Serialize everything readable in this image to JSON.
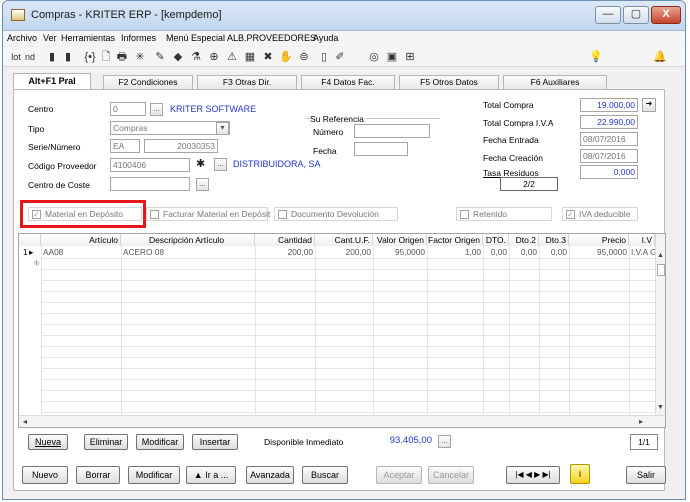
{
  "window": {
    "title": "Compras - KRITER ERP - [kempdemo]",
    "minimize": "—",
    "maximize": "▢",
    "close": "X"
  },
  "menu": [
    "Archivo",
    "Ver",
    "Herramientas",
    "Informes",
    "Menú Especial ALB.PROVEEDORES",
    "Ayuda"
  ],
  "toolbar_icons": [
    "list-icon",
    "edit-icon",
    "first-icon",
    "prev-icon",
    "bracket-icon",
    "preview-icon",
    "print-icon",
    "star-icon",
    "tool-icon",
    "chart-icon",
    "filter-icon",
    "ring-icon",
    "warning-icon",
    "calculator-icon",
    "cross-icon",
    "hand-icon",
    "sync-icon",
    "bookmark-icon",
    "attach-icon",
    "eye-icon",
    "camera-icon",
    "grid-icon",
    "bulb-icon",
    "bell-icon"
  ],
  "toolbar_glyphs": [
    "lot",
    "nd",
    "▮",
    "▮",
    "{•}",
    "🗋",
    "🖶",
    "✳",
    "✎",
    "◆",
    "⚗",
    "⊕",
    "⚠",
    "▦",
    "✖",
    "✋",
    "⊜",
    "▯",
    "✐",
    "◎",
    "▣",
    "⊞",
    "💡",
    "🔔"
  ],
  "tabs": [
    "Alt+F1 Pral",
    "F2 Condiciones",
    "F3 Otras Dir.",
    "F4 Datos Fac.",
    "F5 Otros Datos",
    "F6 Auxiliares"
  ],
  "form": {
    "centro_label": "Centro",
    "centro_value": "0",
    "centro_name": "KRITER SOFTWARE",
    "tipo_label": "Tipo",
    "tipo_value": "Compras",
    "serie_label": "Serie/Número",
    "serie_value": "EA",
    "numero_value": "20030353",
    "proveedor_label": "Código Proveedor",
    "proveedor_value": "4100406",
    "proveedor_name": "DISTRIBUIDORA, SA",
    "coste_label": "Centro de Coste",
    "su_referencia_label": "Su Referencia",
    "numero_label": "Número",
    "fecha_label": "Fecha",
    "total_compra_label": "Total Compra",
    "total_compra_value": "19.000,00",
    "total_iva_label": "Total Compra I.V.A",
    "total_iva_value": "22.990,00",
    "fecha_entrada_label": "Fecha Entrada",
    "fecha_entrada_value": "08/07/2016",
    "fecha_creacion_label": "Fecha Creación",
    "fecha_creacion_value": "08/07/2016",
    "tasa_label": "Tasa Residuos",
    "tasa_value": "0,000",
    "page_value": "2/2",
    "ellipsis": "...",
    "arrow": "➜"
  },
  "checkboxes": {
    "material": "Material en Depósito",
    "facturar": "Facturar Material en Depósit",
    "devolucion": "Documento Devolución",
    "retenido": "Retenido",
    "iva": "IVA deducible"
  },
  "grid": {
    "headers": [
      "Artículo",
      "Descripción Artículo",
      "Cantidad",
      "Cant.U.F.",
      "Valor Origen",
      "Factor Origen",
      "DTO.",
      "Dto.2",
      "Dto.3",
      "Precio",
      "I.V"
    ],
    "rows": [
      {
        "num": "1",
        "articulo": "AA08",
        "descripcion": "ACERO 08",
        "cantidad": "200,00",
        "cantuf": "200,00",
        "valor": "95,0000",
        "factor": "1,00",
        "dto": "0,00",
        "dto2": "0,00",
        "dto3": "0,00",
        "precio": "95,0000",
        "iv": "I.V.A Ge"
      }
    ],
    "new_row_marker": "⁜"
  },
  "grid_buttons": {
    "nueva": "Nueva",
    "eliminar": "Eliminar",
    "modificar": "Modificar",
    "insertar": "Insertar"
  },
  "disponible": {
    "label": "Disponible Inmediato",
    "value": "93.405,00",
    "pager": "1/1"
  },
  "bottom_buttons": {
    "nuevo": "Nuevo",
    "borrar": "Borrar",
    "modificar": "Modificar",
    "ira": "▲ Ir a ...",
    "avanzada": "Avanzada",
    "buscar": "Buscar",
    "aceptar": "Aceptar",
    "cancelar": "Cancelar",
    "nav": "|◀ ◀ ▶ ▶|",
    "info": "i",
    "salir": "Salir"
  }
}
